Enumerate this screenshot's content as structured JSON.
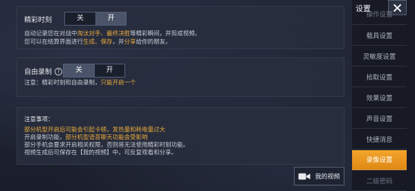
{
  "highlight": {
    "title": "精彩时刻",
    "toggle": {
      "off": "关",
      "on": "开",
      "selected": "on"
    },
    "desc_line1_parts": [
      "自动记录您在对战中",
      "淘汰对手、最终决胜",
      "等精彩瞬间，并剪成视频。"
    ],
    "desc_line2_parts": [
      "您可以在结算界面进行",
      "生成、保存",
      "，并",
      "分享",
      "给你的朋友。"
    ]
  },
  "free_record": {
    "title": "自由录制",
    "help_icon": "question-circle-icon",
    "toggle": {
      "off": "关",
      "on": "开",
      "selected": "off"
    },
    "note_parts": [
      "注意：精彩时刻和自由录制，",
      "只能开启一个"
    ]
  },
  "notes": {
    "title": "注意事项：",
    "lines": [
      {
        "text": "部分机型开启后可能会引起卡顿，发热量和耗电量过大",
        "warn": true
      },
      {
        "text": "开启录制功能，部分机型语音聊天功能会受影响",
        "warn": false,
        "warn_suffix": "部分机型语音聊天功能会受影响",
        "prefix": "开启录制功能，"
      },
      {
        "text": "部分手机会要求开启相关权限，否则将无法使用精彩时刻功能。",
        "warn": false
      },
      {
        "text": "视频生成后可保存在【我的视频】中，可反复观看和分享。",
        "warn": false
      }
    ]
  },
  "my_video_button": {
    "label": "我的视频",
    "icon": "video-camera-icon"
  },
  "sidebar": {
    "title": "设置",
    "close_icon": "close-icon",
    "items": [
      {
        "label": "操作设置",
        "active": false,
        "faded": true
      },
      {
        "label": "载具设置",
        "active": false
      },
      {
        "label": "灵敏度设置",
        "active": false
      },
      {
        "label": "拾取设置",
        "active": false
      },
      {
        "label": "效果设置",
        "active": false
      },
      {
        "label": "声音设置",
        "active": false
      },
      {
        "label": "快捷消息",
        "active": false
      },
      {
        "label": "录像设置",
        "active": true
      },
      {
        "label": "二级密码",
        "active": false,
        "faded": true
      }
    ]
  },
  "colors": {
    "accent": "#e8a93a",
    "active_tab": "#f2a52b"
  }
}
